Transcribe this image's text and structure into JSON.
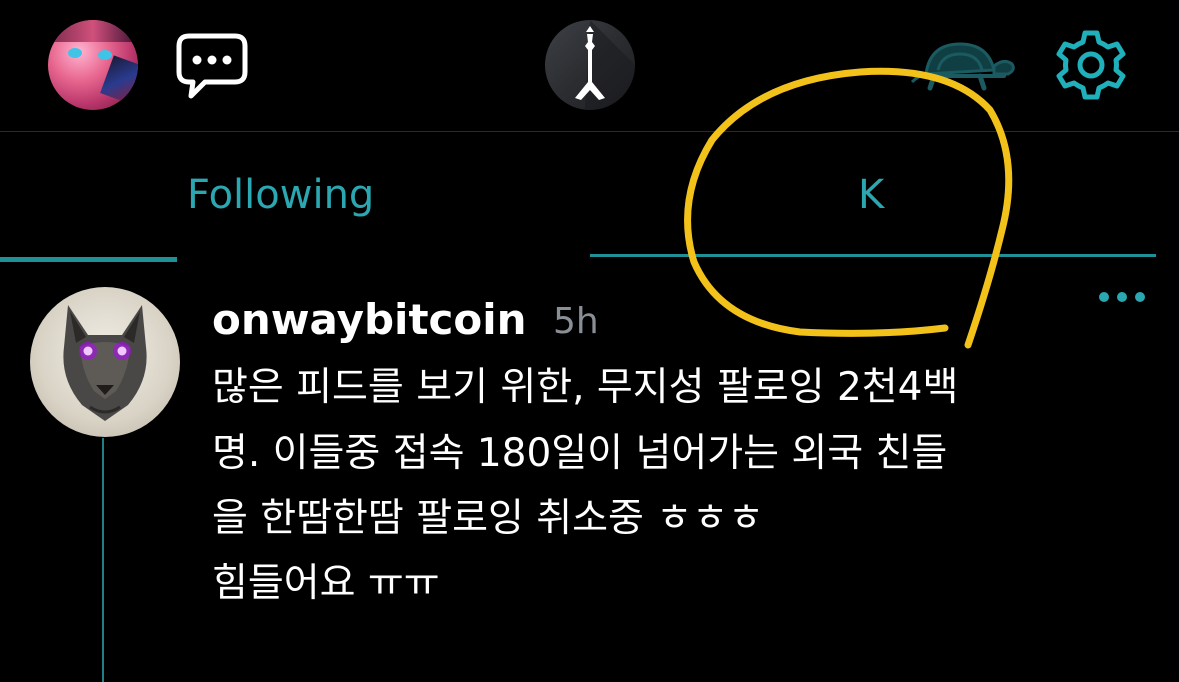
{
  "colors": {
    "background": "#000000",
    "accent": "#2aa7b0",
    "annotation": "#f2c21b",
    "muted": "#8a8f95"
  },
  "icons": {
    "chat": "speech-bubble-icon",
    "turtle": "turtle-icon",
    "settings": "gear-icon",
    "more": "more-dots-icon"
  },
  "tabs": [
    {
      "label": "Following"
    },
    {
      "label": "K"
    }
  ],
  "post": {
    "author": "onwaybitcoin",
    "time": "5h",
    "lines": [
      "많은 피드를 보기 위한, 무지성 팔로잉 2천4백",
      "명.  이들중 접속 180일이 넘어가는 외국 친들",
      "을 한땀한땀 팔로잉 취소중 ㅎㅎㅎ",
      "힘들어요 ㅠㅠ"
    ]
  }
}
